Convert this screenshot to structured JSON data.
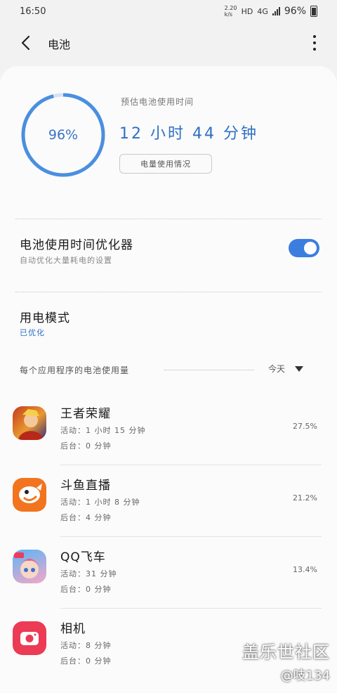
{
  "status": {
    "time": "16:50",
    "net_speed": "2.20 k/s",
    "hd": "HD",
    "network": "4G",
    "battery": "96%"
  },
  "header": {
    "title": "电池"
  },
  "battery": {
    "percent_label": "96%",
    "level": 0.96,
    "estimate_label": "预估电池使用时间",
    "estimate_time": "12 小时 44 分钟",
    "usage_button": "电量使用情况"
  },
  "optimizer": {
    "title": "电池使用时间优化器",
    "subtitle": "自动优化大量耗电的设置",
    "enabled": true
  },
  "power_mode": {
    "title": "用电模式",
    "value": "已优化"
  },
  "per_app": {
    "label": "每个应用程序的电池使用量",
    "period": "今天"
  },
  "apps": [
    {
      "name": "王者荣耀",
      "active": "活动：1 小时 15 分钟",
      "background": "后台：0 分钟",
      "percent": "27.5%",
      "icon": "honor-of-kings-icon"
    },
    {
      "name": "斗鱼直播",
      "active": "活动：1 小时 8 分钟",
      "background": "后台：4 分钟",
      "percent": "21.2%",
      "icon": "douyu-icon"
    },
    {
      "name": "QQ飞车",
      "active": "活动：31 分钟",
      "background": "后台：0 分钟",
      "percent": "13.4%",
      "icon": "qq-speed-icon"
    },
    {
      "name": "相机",
      "active": "活动：8 分钟",
      "background": "后台：0 分钟",
      "percent": "",
      "icon": "camera-icon"
    }
  ],
  "watermark": {
    "main": "盖乐世社区",
    "sub": "@吱134"
  },
  "colors": {
    "accent": "#3b7ee0",
    "ring": "#4a8fe0",
    "ring_track": "#d6e3f5"
  }
}
